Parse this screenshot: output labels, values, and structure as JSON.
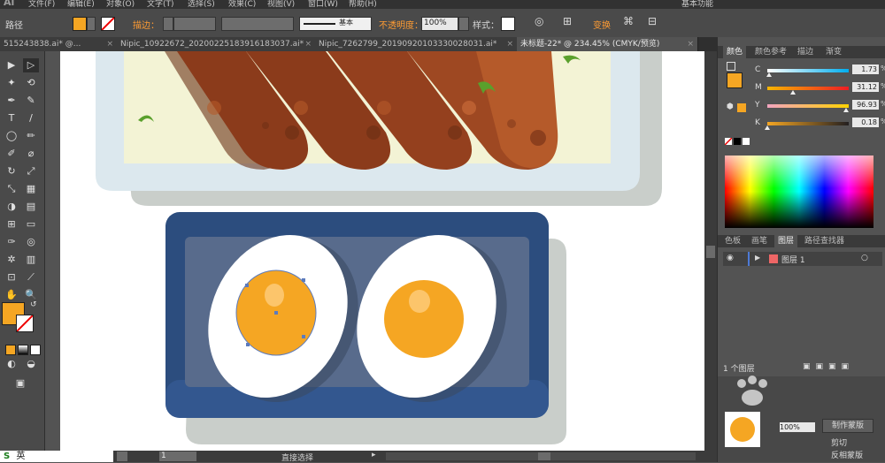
{
  "app": {
    "logo": "Ai"
  },
  "menu": {
    "items": [
      "文件(F)",
      "编辑(E)",
      "对象(O)",
      "文字(T)",
      "选择(S)",
      "效果(C)",
      "视图(V)",
      "窗口(W)",
      "帮助(H)"
    ],
    "workspace": "基本功能"
  },
  "control_bar": {
    "selection_label": "路径",
    "stroke_label": "描边：",
    "stroke_style": "基本",
    "opacity_label": "不透明度：",
    "opacity_value": "100%",
    "style_label": "样式：",
    "transform_label": "变换",
    "fill_color": "#f5a623"
  },
  "tabs": [
    {
      "label": "51524383 8.ai* @...",
      "text": "515243838.ai* @..."
    },
    {
      "label": "Nipic_10922672_20200225183916183037.ai*"
    },
    {
      "label": "Nipic_7262799_20190920103330028031.ai*"
    },
    {
      "label": "未标题-22* @ 234.45% (CMYK/预览)"
    }
  ],
  "tab_texts": [
    "515243838.ai* @...",
    "Nipic_10922672_20200225183916183037.ai*",
    "Nipic_7262799_20190920103330028031.ai*",
    "未标题-22* @ 234.45% (CMYK/预览)"
  ],
  "tools": [
    "▶",
    "▷",
    "✦",
    "⟲",
    "✒",
    "✎",
    "T",
    "/",
    "◯",
    "✏",
    "✐",
    "⌀",
    "↻",
    "⤢",
    "⤡",
    "▦",
    "✋",
    "🔍"
  ],
  "color_panel": {
    "tabs": [
      "颜色",
      "颜色参考",
      "描边",
      "渐变"
    ],
    "active_tab": "颜色",
    "channels": [
      {
        "name": "C",
        "value": "1.73",
        "unit": "%",
        "level": 0.02
      },
      {
        "name": "M",
        "value": "31.12",
        "unit": "%",
        "level": 0.31
      },
      {
        "name": "Y",
        "value": "96.93",
        "unit": "%",
        "level": 0.97
      },
      {
        "name": "K",
        "value": "0.18",
        "unit": "%",
        "level": 0.0
      }
    ]
  },
  "layers_panel": {
    "tabs": [
      "色板",
      "画笔",
      "图层",
      "路径查找器"
    ],
    "active_tab": "图层",
    "layer_name": "图层 1",
    "footer": "1 个图层"
  },
  "bottom_panel": {
    "make_mask": "制作蒙版",
    "clip": "剪切",
    "invert": "反相蒙版",
    "opacity": "100%"
  },
  "status": {
    "zoom": "234.45",
    "page": "1",
    "tool": "直接选择"
  },
  "ime": {
    "label": "英"
  },
  "watermark": "Baidu"
}
